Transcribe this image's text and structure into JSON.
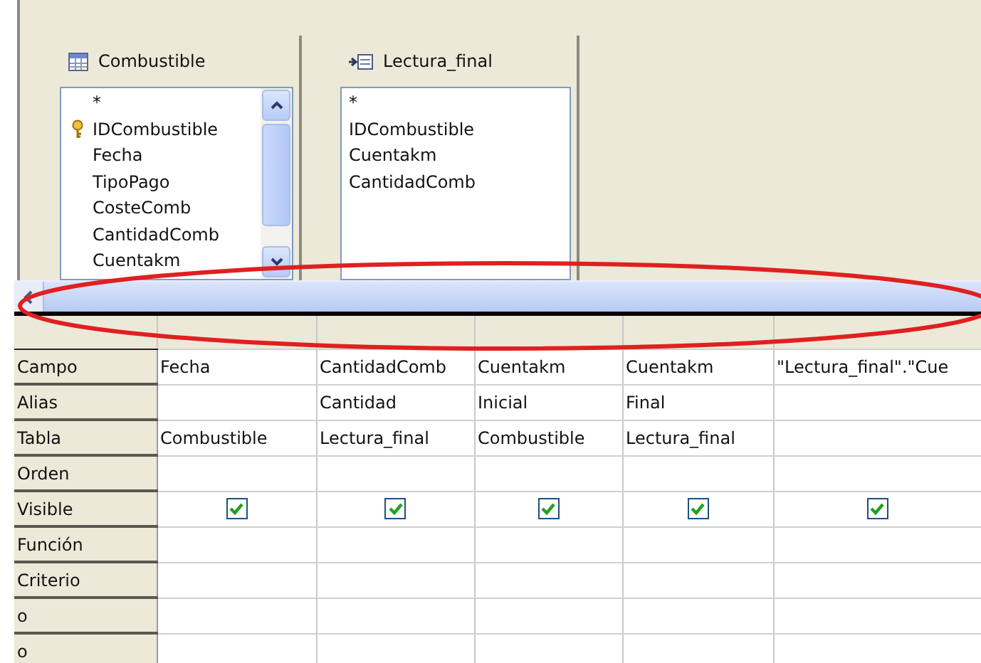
{
  "tables": [
    {
      "name": "Combustible",
      "kind": "table",
      "scrollable": true,
      "fields": [
        {
          "name": "*",
          "key": false
        },
        {
          "name": "IDCombustible",
          "key": true
        },
        {
          "name": "Fecha",
          "key": false
        },
        {
          "name": "TipoPago",
          "key": false
        },
        {
          "name": "CosteComb",
          "key": false
        },
        {
          "name": "CantidadComb",
          "key": false
        },
        {
          "name": "Cuentakm",
          "key": false
        }
      ]
    },
    {
      "name": "Lectura_final",
      "kind": "query",
      "scrollable": false,
      "fields": [
        {
          "name": "*",
          "key": false
        },
        {
          "name": "IDCombustible",
          "key": false
        },
        {
          "name": "Cuentakm",
          "key": false
        },
        {
          "name": "CantidadComb",
          "key": false
        }
      ]
    }
  ],
  "scrollbar": {
    "highlighted": true
  },
  "grid": {
    "rows": [
      {
        "label": "Campo",
        "kind": "campo"
      },
      {
        "label": "Alias",
        "kind": "alias"
      },
      {
        "label": "Tabla",
        "kind": "tabla"
      },
      {
        "label": "Orden",
        "kind": "orden"
      },
      {
        "label": "Visible",
        "kind": "visible"
      },
      {
        "label": "Función",
        "kind": "funcion"
      },
      {
        "label": "Criterio",
        "kind": "criterio"
      },
      {
        "label": "o",
        "kind": "o"
      },
      {
        "label": "o",
        "kind": "o"
      }
    ],
    "columns": [
      {
        "campo": "Fecha",
        "tabla": "Combustible",
        "visible": true
      },
      {
        "campo": "CantidadComb",
        "alias": "Cantidad",
        "tabla": "Lectura_final",
        "visible": true
      },
      {
        "campo": "Cuentakm",
        "alias": "Inicial",
        "tabla": "Combustible",
        "visible": true
      },
      {
        "campo": "Cuentakm",
        "alias": "Final",
        "tabla": "Lectura_final",
        "visible": true
      },
      {
        "campo": "\"Lectura_final\".\"Cue",
        "visible": true
      }
    ]
  }
}
